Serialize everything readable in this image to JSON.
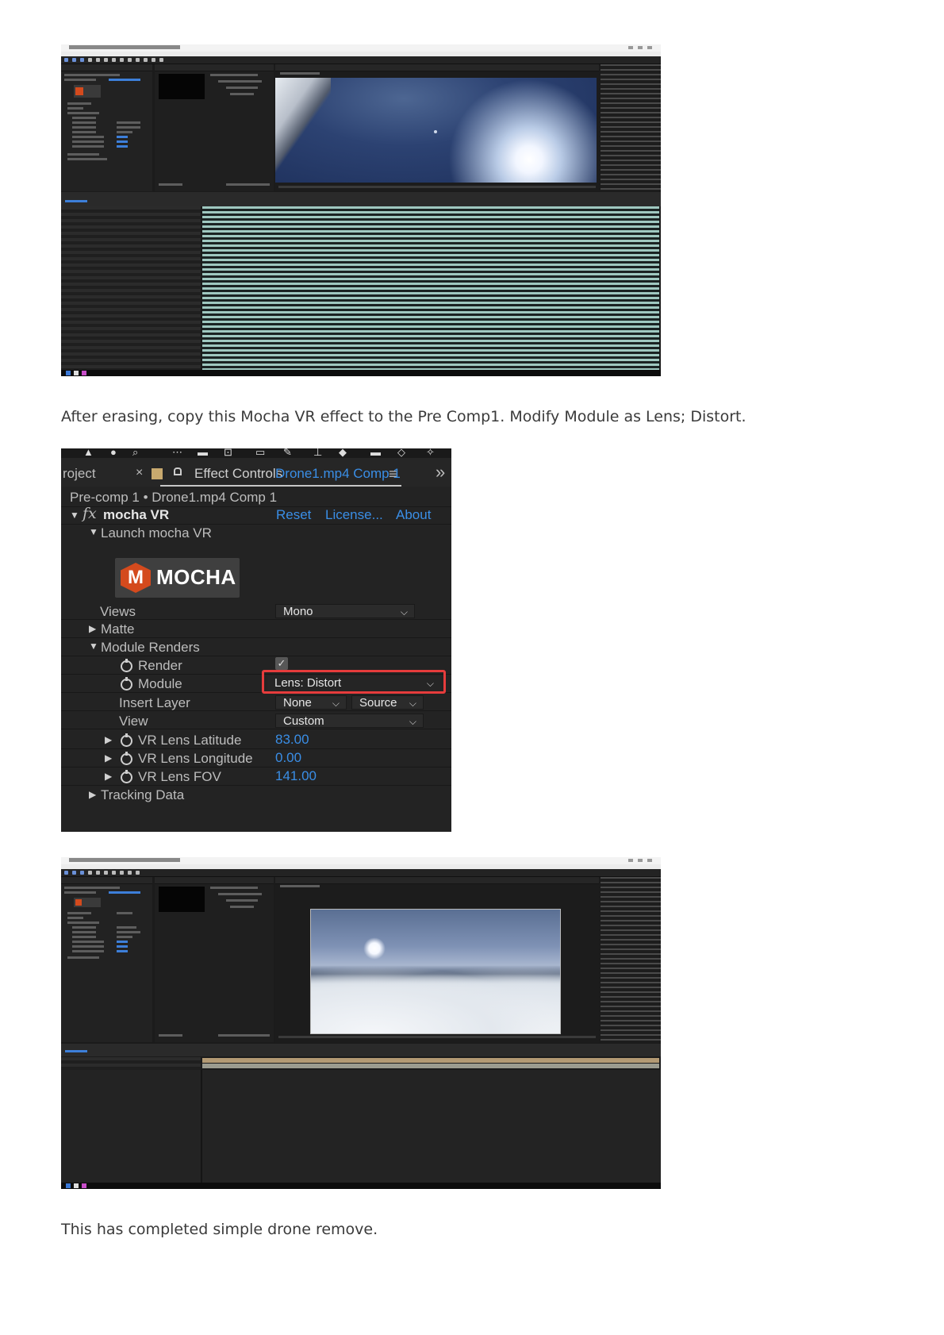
{
  "document": {
    "para1": "After erasing, copy this Mocha VR effect to the Pre Comp1. Modify Module as Lens; Distort.",
    "para2": "This has completed simple drone remove."
  },
  "effect_controls": {
    "tab_project": "roject",
    "tab_close": "×",
    "tab_effect_controls": "Effect Controls",
    "tab_comp": "Drone1.mp4 Comp 1",
    "menu_icon": "≡",
    "expand_icon": "»",
    "breadcrumb": "Pre-comp 1 • Drone1.mp4 Comp 1",
    "effect_name": "mocha VR",
    "fx_symbol": "fx",
    "reset": "Reset",
    "license": "License...",
    "about": "About",
    "launch": "Launch mocha VR",
    "logo_letter": "M",
    "logo_word": "MOCHA",
    "views_label": "Views",
    "views_value": "Mono",
    "matte_label": "Matte",
    "module_renders_label": "Module Renders",
    "render_label": "Render",
    "render_checked": true,
    "module_label": "Module",
    "module_value": "Lens: Distort",
    "insert_layer_label": "Insert Layer",
    "insert_layer_value": "None",
    "insert_layer_source": "Source",
    "view_label": "View",
    "view_value": "Custom",
    "lat_label": "VR Lens Latitude",
    "lat_value": "83.00",
    "lon_label": "VR Lens Longitude",
    "lon_value": "0.00",
    "fov_label": "VR Lens FOV",
    "fov_value": "141.00",
    "tracking_label": "Tracking Data",
    "highlight_color": "#e63c3c"
  }
}
